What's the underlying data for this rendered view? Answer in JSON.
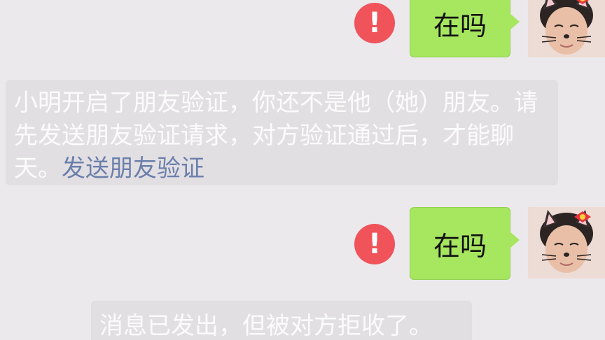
{
  "messages": [
    {
      "text": "在吗",
      "status_icon": "exclamation-icon"
    },
    {
      "text": "在吗",
      "status_icon": "exclamation-icon"
    }
  ],
  "notices": {
    "verification": {
      "text": "小明开启了朋友验证，你还不是他（她）朋友。请先发送朋友验证请求，对方验证通过后，才能聊天。",
      "link": "发送朋友验证"
    },
    "rejected": {
      "text": "消息已发出，但被对方拒收了。"
    }
  },
  "colors": {
    "background": "#ece9ed",
    "bubble_green": "#a7e65f",
    "error_red": "#f0535a",
    "link_blue": "#6b7fab",
    "notice_bg": "#e2dfe3"
  }
}
